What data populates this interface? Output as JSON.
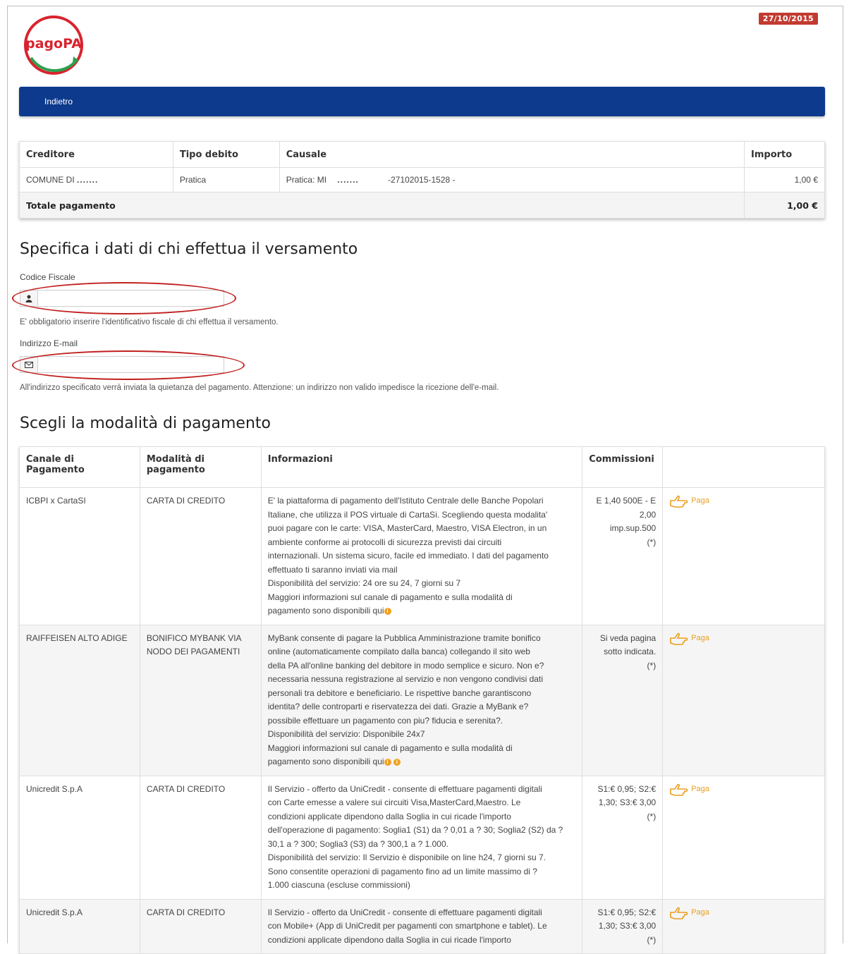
{
  "header": {
    "logo_text": "pagoPA",
    "date": "27/10/2015",
    "nav_back_label": "Indietro"
  },
  "summary": {
    "columns": [
      "Creditore",
      "Tipo debito",
      "Causale",
      "Importo"
    ],
    "row": {
      "creditore": "COMUNE DI",
      "creditore_mask": ".......",
      "tipo": "Pratica",
      "causale_prefix": "Pratica: MI",
      "causale_mask": ".......",
      "causale_suffix": "-27102015-1528 -",
      "importo": "1,00 €"
    },
    "total_label": "Totale pagamento",
    "total_value": "1,00 €"
  },
  "payer": {
    "title": "Specifica i dati di chi effettua il versamento",
    "codice_label": "Codice Fiscale",
    "codice_value": "",
    "codice_hint": "E' obbligatorio inserire l'identificativo fiscale di chi effettua il versamento.",
    "email_label": "Indirizzo E-mail",
    "email_value": "",
    "email_hint": "All'indirizzo specificato verrà inviata la quietanza del pagamento. Attenzione: un indirizzo non valido impedisce la ricezione dell'e-mail.",
    "user_icon": "user-icon",
    "mail_icon": "envelope-icon",
    "highlight_color": "#c0201f"
  },
  "methods": {
    "title": "Scegli la modalità di pagamento",
    "columns": [
      "Canale di Pagamento",
      "Modalità di pagamento",
      "Informazioni",
      "Commissioni",
      ""
    ],
    "pay_label": "Paga",
    "rows": [
      {
        "canale": "ICBPI x CartaSI",
        "modalita": "CARTA DI CREDITO",
        "info": [
          "E' la piattaforma di pagamento dell'Istituto Centrale delle Banche Popolari",
          "Italiane, che utilizza il POS virtuale di CartaSi. Scegliendo questa modalita'",
          "puoi pagare con le carte: VISA, MasterCard, Maestro, VISA Electron, in un",
          "ambiente conforme ai protocolli di sicurezza previsti dai circuiti",
          "internazionali. Un sistema sicuro, facile ed immediato. I dati del pagamento",
          "effettuato ti saranno inviati via mail",
          "Disponibilità del servizio: 24 ore su 24, 7 giorni su 7",
          "Maggiori informazioni sul canale di pagamento e sulla modalità di",
          "pagamento sono disponibili qui"
        ],
        "commissioni": [
          "E 1,40 500E - E",
          "2,00",
          "imp.sup.500",
          "(*)"
        ]
      },
      {
        "canale": "RAIFFEISEN ALTO ADIGE",
        "modalita": "BONIFICO MYBANK VIA NODO DEI PAGAMENTI",
        "info": [
          "MyBank consente di pagare la Pubblica Amministrazione tramite bonifico",
          "online (automaticamente compilato dalla banca) collegando il sito web",
          "della PA all'online banking del debitore in modo semplice e sicuro. Non e?",
          "necessaria nessuna registrazione al servizio e non vengono condivisi dati",
          "personali tra debitore e beneficiario. Le rispettive banche garantiscono",
          "identita? delle controparti e riservatezza dei dati. Grazie a MyBank e?",
          "possibile effettuare un pagamento con piu? fiducia e serenita?.",
          "Disponibilità del servizio: Disponibile 24x7",
          "Maggiori informazioni sul canale di pagamento e sulla modalità di",
          "pagamento sono disponibili qui"
        ],
        "commissioni": [
          "Si veda pagina",
          "sotto indicata.",
          "(*)"
        ]
      },
      {
        "canale": "Unicredit S.p.A",
        "modalita": "CARTA DI CREDITO",
        "info": [
          "Il Servizio - offerto da UniCredit - consente di effettuare pagamenti digitali",
          "con Carte emesse a valere sui circuiti Visa,MasterCard,Maestro. Le",
          "condizioni applicate dipendono dalla Soglia in cui ricade l'importo",
          "dell'operazione di pagamento: Soglia1 (S1) da ? 0,01 a ? 30; Soglia2 (S2) da ?",
          "30,1 a ? 300; Soglia3 (S3) da ? 300,1 a ? 1.000.",
          "Disponibilità del servizio: Il Servizio è disponibile on line h24, 7 giorni su 7.",
          "Sono consentite operazioni di pagamento fino ad un limite massimo di ?",
          "1.000 ciascuna (escluse commissioni)"
        ],
        "commissioni": [
          "S1:€ 0,95; S2:€",
          "1,30; S3:€ 3,00",
          "(*)"
        ]
      },
      {
        "canale": "Unicredit S.p.A",
        "modalita": "CARTA DI CREDITO",
        "info": [
          "Il Servizio - offerto da UniCredit - consente di effettuare pagamenti digitali",
          "con Mobile+ (App di UniCredit per pagamenti con smartphone e tablet). Le",
          "condizioni applicate dipendono dalla Soglia in cui ricade l'importo"
        ],
        "commissioni": [
          "S1:€ 0,95; S2:€",
          "1,30; S3:€ 3,00",
          "(*)"
        ]
      }
    ]
  },
  "colors": {
    "navbar": "#0d3a8c",
    "badge": "#c23b30",
    "paga": "#e8a020",
    "logo_red": "#d9232e",
    "logo_green": "#2fa04f"
  }
}
